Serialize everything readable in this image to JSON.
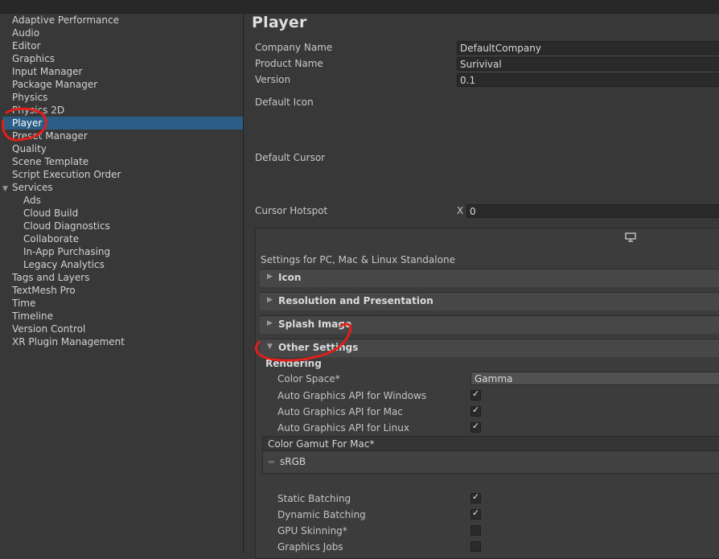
{
  "sidebar": {
    "items": [
      {
        "label": "Adaptive Performance"
      },
      {
        "label": "Audio"
      },
      {
        "label": "Editor"
      },
      {
        "label": "Graphics"
      },
      {
        "label": "Input Manager"
      },
      {
        "label": "Package Manager"
      },
      {
        "label": "Physics"
      },
      {
        "label": "Physics 2D"
      },
      {
        "label": "Player",
        "selected": true
      },
      {
        "label": "Preset Manager"
      },
      {
        "label": "Quality"
      },
      {
        "label": "Scene Template"
      },
      {
        "label": "Script Execution Order"
      },
      {
        "label": "Services",
        "expanded": true
      },
      {
        "label": "Ads",
        "child": true
      },
      {
        "label": "Cloud Build",
        "child": true
      },
      {
        "label": "Cloud Diagnostics",
        "child": true
      },
      {
        "label": "Collaborate",
        "child": true
      },
      {
        "label": "In-App Purchasing",
        "child": true
      },
      {
        "label": "Legacy Analytics",
        "child": true
      },
      {
        "label": "Tags and Layers"
      },
      {
        "label": "TextMesh Pro"
      },
      {
        "label": "Time"
      },
      {
        "label": "Timeline"
      },
      {
        "label": "Version Control"
      },
      {
        "label": "XR Plugin Management"
      }
    ]
  },
  "player": {
    "title": "Player",
    "company_name_label": "Company Name",
    "company_name_value": "DefaultCompany",
    "product_name_label": "Product Name",
    "product_name_value": "Surivival",
    "version_label": "Version",
    "version_value": "0.1",
    "default_icon_label": "Default Icon",
    "default_cursor_label": "Default Cursor",
    "cursor_hotspot_label": "Cursor Hotspot",
    "cursor_hotspot_x_label": "X",
    "cursor_hotspot_x_value": "0"
  },
  "platform": {
    "icon": "monitor-icon",
    "label": "Settings for PC, Mac & Linux Standalone",
    "foldouts": {
      "icon": "Icon",
      "resolution": "Resolution and Presentation",
      "splash": "Splash Image",
      "other": "Other Settings"
    }
  },
  "other_settings": {
    "rendering_header": "Rendering",
    "color_space_label": "Color Space*",
    "color_space_value": "Gamma",
    "auto_api_windows_label": "Auto Graphics API  for Windows",
    "auto_api_windows": true,
    "auto_api_mac_label": "Auto Graphics API  for Mac",
    "auto_api_mac": true,
    "auto_api_linux_label": "Auto Graphics API  for Linux",
    "auto_api_linux": true,
    "color_gamut_header": "Color Gamut For Mac*",
    "color_gamut_item": "sRGB",
    "static_batching_label": "Static Batching",
    "static_batching": true,
    "dynamic_batching_label": "Dynamic Batching",
    "dynamic_batching": true,
    "gpu_skinning_label": "GPU Skinning*",
    "gpu_skinning": false,
    "graphics_jobs_label": "Graphics Jobs",
    "graphics_jobs": false
  },
  "colors": {
    "selection": "#2c5d87",
    "annotation": "#e0201a"
  }
}
